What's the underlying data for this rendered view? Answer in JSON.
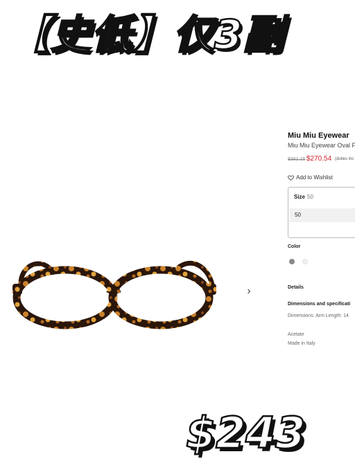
{
  "overlay": {
    "headline": "【史低】仅3副",
    "price_tag": "$243"
  },
  "product": {
    "brand": "Miu Miu Eyewear",
    "name": "Miu Miu Eyewear Oval F",
    "old_price": "$381.15",
    "sale_price": "$270.54",
    "duties_note": "(duties inc",
    "wishlist_label": "Add to Wishlist",
    "size": {
      "label": "Size",
      "selected": "50",
      "option": "50"
    },
    "color_label": "Color",
    "swatches": [
      "#8a8a8a",
      "#f0f0f0"
    ],
    "details_label": "Details",
    "dimensions_title": "Dimensions and specificati",
    "dimensions_text": "Dimensions: Arm Length: 14",
    "material": "Acetate",
    "origin": "Made in Italy"
  },
  "gallery": {
    "next_arrow": "›"
  },
  "colors": {
    "sale": "#d6232a",
    "tortoise_dark": "#2a160b",
    "tortoise_light": "#d9902e"
  }
}
